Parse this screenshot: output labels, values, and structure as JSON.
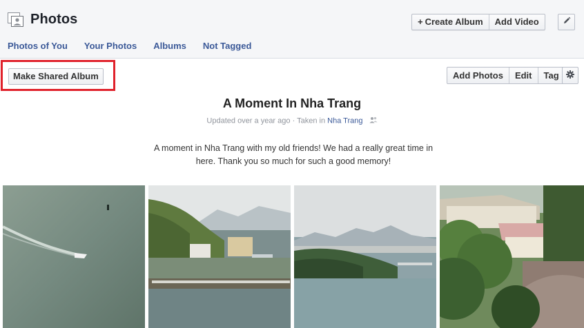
{
  "header": {
    "title": "Photos",
    "create_album_label": "Create Album",
    "add_video_label": "Add Video"
  },
  "subnav": {
    "items": [
      {
        "label": "Photos of You"
      },
      {
        "label": "Your Photos"
      },
      {
        "label": "Albums"
      },
      {
        "label": "Not Tagged"
      }
    ]
  },
  "toolbar": {
    "make_shared_album_label": "Make Shared Album",
    "add_photos_label": "Add Photos",
    "edit_label": "Edit",
    "tag_label": "Tag"
  },
  "album": {
    "title": "A Moment In Nha Trang",
    "updated_text": "Updated over a year ago",
    "taken_in_prefix": "· Taken in",
    "location": "Nha Trang",
    "description": "A moment in Nha Trang with my old friends! We had a really great time in here. Thank you so much for such a good memory!"
  },
  "icons": {
    "photos": "photos-icon",
    "pencil": "pencil-icon",
    "gear": "gear-icon",
    "people": "people-icon"
  },
  "colors": {
    "link": "#3b5998",
    "highlight": "#e0212b",
    "header_bg": "#f5f6f8"
  }
}
